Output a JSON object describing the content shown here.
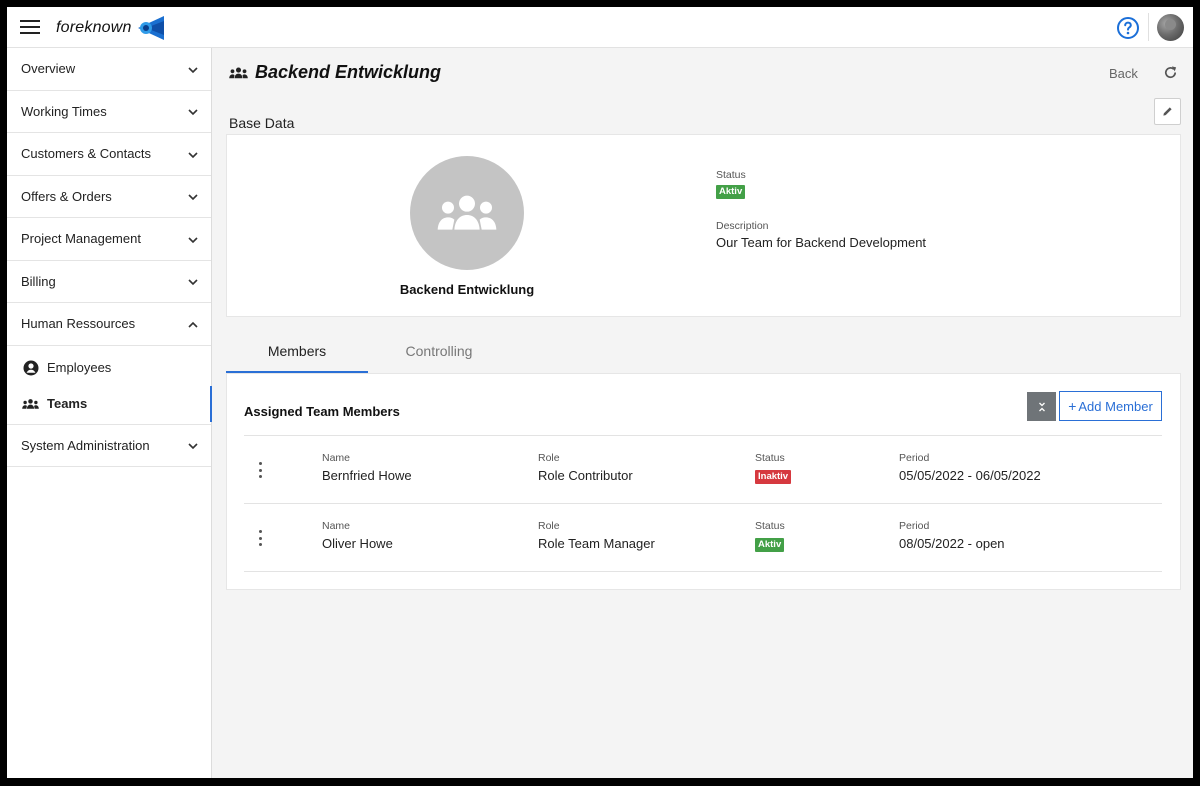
{
  "app": {
    "logo_text": "foreknown"
  },
  "sidebar": {
    "items": [
      {
        "label": "Overview"
      },
      {
        "label": "Working Times"
      },
      {
        "label": "Customers & Contacts"
      },
      {
        "label": "Offers & Orders"
      },
      {
        "label": "Project Management"
      },
      {
        "label": "Billing"
      },
      {
        "label": "Human Ressources"
      }
    ],
    "sub_items": [
      {
        "label": "Employees",
        "icon": "person-circle-icon"
      },
      {
        "label": "Teams",
        "icon": "team-icon"
      }
    ],
    "last_item": {
      "label": "System Administration"
    }
  },
  "header": {
    "title": "Backend Entwicklung",
    "back_label": "Back"
  },
  "base_data": {
    "section_title": "Base Data",
    "team_name": "Backend Entwicklung",
    "status_label": "Status",
    "status_value": "Aktiv",
    "description_label": "Description",
    "description_value": "Our Team for Backend Development"
  },
  "tabs": [
    {
      "label": "Members",
      "active": true
    },
    {
      "label": "Controlling",
      "active": false
    }
  ],
  "members": {
    "title": "Assigned Team Members",
    "add_label": "Add Member",
    "columns": {
      "name": "Name",
      "role": "Role",
      "status": "Status",
      "period": "Period"
    },
    "rows": [
      {
        "name": "Bernfried Howe",
        "role": "Role Contributor",
        "status": "Inaktiv",
        "status_color": "#d6393f",
        "period": "05/05/2022 - 06/05/2022"
      },
      {
        "name": "Oliver Howe",
        "role": "Role Team Manager",
        "status": "Aktiv",
        "status_color": "#43a047",
        "period": "08/05/2022 - open"
      }
    ]
  },
  "colors": {
    "accent": "#2a6fd6",
    "active_green": "#43a047",
    "inactive_red": "#d6393f"
  }
}
